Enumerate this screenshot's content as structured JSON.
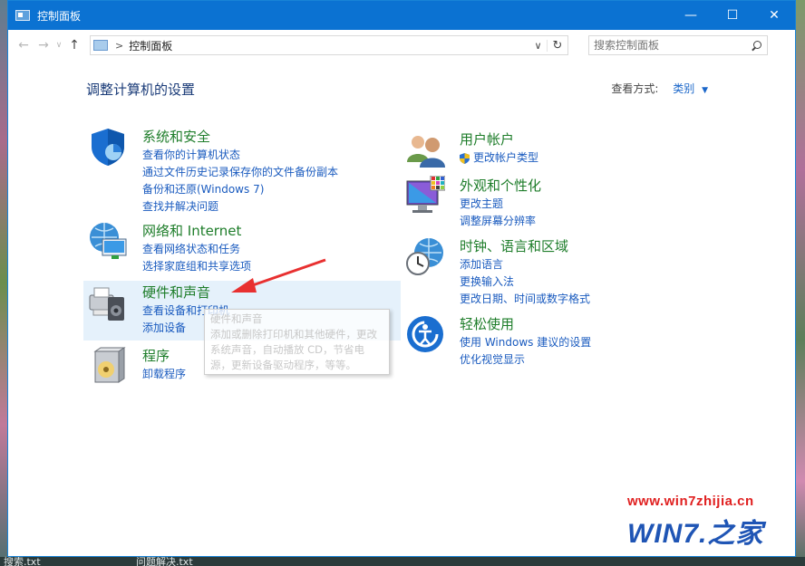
{
  "window": {
    "title": "控制面板",
    "controls": {
      "minimize": "—",
      "maximize": "☐",
      "close": "✕"
    }
  },
  "nav": {
    "back": "←",
    "forward": "→",
    "recent": "∨",
    "up": "↑",
    "breadcrumb": "控制面板",
    "search_placeholder": "搜索控制面板"
  },
  "main": {
    "heading": "调整计算机的设置",
    "view_by_label": "查看方式:",
    "view_by_value": "类别"
  },
  "categories_left": [
    {
      "title": "系统和安全",
      "links": [
        "查看你的计算机状态",
        "通过文件历史记录保存你的文件备份副本",
        "备份和还原(Windows 7)",
        "查找并解决问题"
      ]
    },
    {
      "title": "网络和 Internet",
      "links": [
        "查看网络状态和任务",
        "选择家庭组和共享选项"
      ]
    },
    {
      "title": "硬件和声音",
      "links": [
        "查看设备和打印机",
        "添加设备"
      ]
    },
    {
      "title": "程序",
      "links": [
        "卸载程序"
      ]
    }
  ],
  "categories_right": [
    {
      "title": "用户帐户",
      "links": [
        "更改帐户类型"
      ]
    },
    {
      "title": "外观和个性化",
      "links": [
        "更改主题",
        "调整屏幕分辨率"
      ]
    },
    {
      "title": "时钟、语言和区域",
      "links": [
        "添加语言",
        "更换输入法",
        "更改日期、时间或数字格式"
      ]
    },
    {
      "title": "轻松使用",
      "links": [
        "使用 Windows 建议的设置",
        "优化视觉显示"
      ]
    }
  ],
  "tooltip": {
    "title": "硬件和声音",
    "line1": "添加或删除打印机和其他硬件，更改",
    "line2": "系统声音，自动播放 CD，节省电",
    "line3": "源，更新设备驱动程序，等等。"
  },
  "watermark": {
    "url": "www.win7zhijia.cn",
    "logo": "WIN7.之家"
  },
  "desktop": {
    "taskbar_text_1": "搜索.txt",
    "taskbar_text_2": "问题解决.txt"
  },
  "colors": {
    "titlebar": "#0b72d2",
    "category_title": "#1e7d2a",
    "link": "#1a5bbf",
    "heading": "#1a3b78",
    "highlight": "#e5f1fb",
    "arrow": "#e83030"
  }
}
